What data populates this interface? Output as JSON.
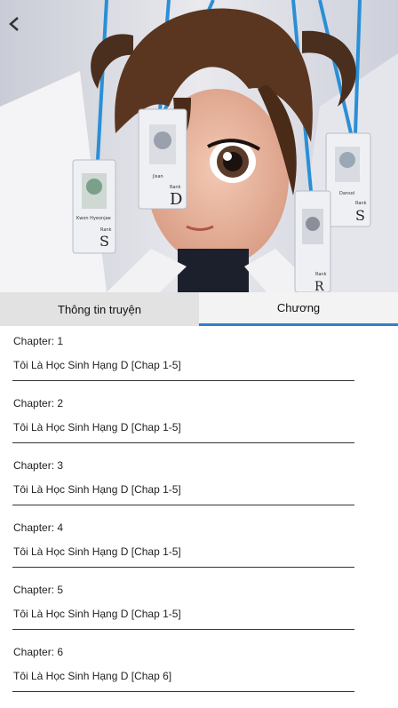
{
  "tabs": {
    "info_label": "Thông tin truyện",
    "chapters_label": "Chương",
    "active": "chapters"
  },
  "chapters": [
    {
      "number_label": "Chapter: 1",
      "title": "Tôi Là Học Sinh Hạng D [Chap 1-5]"
    },
    {
      "number_label": "Chapter: 2",
      "title": "Tôi Là Học Sinh Hạng D [Chap 1-5]"
    },
    {
      "number_label": "Chapter: 3",
      "title": "Tôi Là Học Sinh Hạng D [Chap 1-5]"
    },
    {
      "number_label": "Chapter: 4",
      "title": "Tôi Là Học Sinh Hạng D [Chap 1-5]"
    },
    {
      "number_label": "Chapter: 5",
      "title": "Tôi Là Học Sinh Hạng D [Chap 1-5]"
    },
    {
      "number_label": "Chapter: 6",
      "title": "Tôi Là Học Sinh Hạng D [Chap 6]"
    }
  ],
  "cover_art": {
    "card_text": [
      "Kwon Hyeonjae",
      "Rank",
      "S",
      "Jisan",
      "Rank",
      "D",
      "Dansol",
      "Rank",
      "S",
      "Rank",
      "R"
    ]
  },
  "colors": {
    "accent": "#2f7fd1",
    "lanyard": "#2a8fd6",
    "hair": "#5a3620"
  }
}
